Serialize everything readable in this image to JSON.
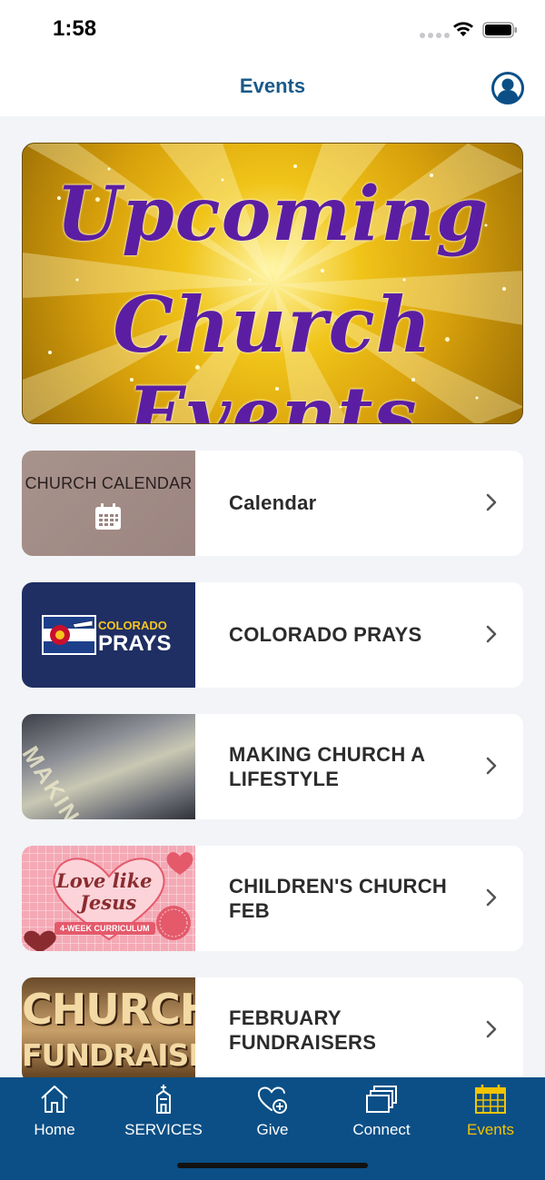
{
  "status_bar": {
    "time": "1:58"
  },
  "header": {
    "title": "Events"
  },
  "banner": {
    "line1": "Upcoming",
    "line2": "Church Events"
  },
  "events": [
    {
      "title": "Calendar",
      "thumb_text": "CHURCH CALENDAR"
    },
    {
      "title": "COLORADO PRAYS",
      "thumb_text_top": "COLORADO",
      "thumb_text_bottom": "PRAYS"
    },
    {
      "title": "MAKING CHURCH A LIFESTYLE",
      "thumb_text": "MAKING CHURCH A LIFESTYLE"
    },
    {
      "title": "CHILDREN'S CHURCH FEB",
      "thumb_line1": "Love like",
      "thumb_line2": "Jesus",
      "thumb_badge": "4-WEEK CURRICULUM"
    },
    {
      "title": "FEBRUARY FUNDRAISERS",
      "thumb_line1": "CHURCH",
      "thumb_line2": "FUNDRAISING"
    }
  ],
  "tab_bar": {
    "items": [
      {
        "label": "Home",
        "icon": "home-icon"
      },
      {
        "label": "SERVICES",
        "icon": "church-icon"
      },
      {
        "label": "Give",
        "icon": "heart-plus-icon"
      },
      {
        "label": "Connect",
        "icon": "stacked-windows-icon"
      },
      {
        "label": "Events",
        "icon": "calendar-icon"
      }
    ],
    "active": "Events"
  },
  "colors": {
    "accent": "#1a5a8a",
    "tab_bar": "#0b4f86",
    "active_tab": "#f5c400",
    "banner_text": "#5b1ea3"
  }
}
